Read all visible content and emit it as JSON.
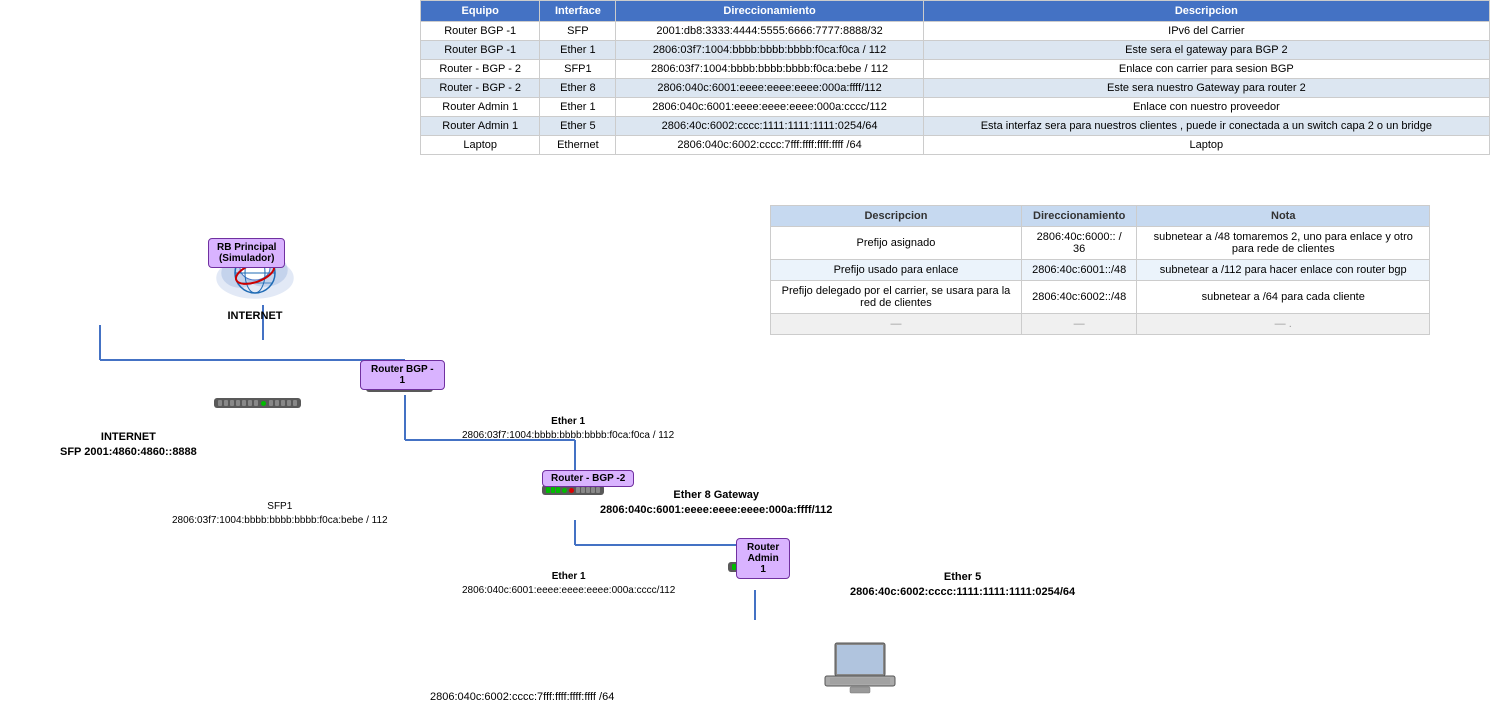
{
  "colors": {
    "header_bg": "#4472c4",
    "header_text": "#ffffff",
    "row_odd": "#ffffff",
    "row_even": "#dce6f1",
    "bottom_header": "#c6d9f0",
    "bottom_even": "#ebf3fb",
    "box_bg": "#d9b3ff",
    "box_border": "#7030a0"
  },
  "top_table": {
    "headers": [
      "Equipo",
      "Interface",
      "Direccionamiento",
      "Descripcion"
    ],
    "rows": [
      {
        "equipo": "Router BGP -1",
        "interface": "SFP",
        "direccionamiento": "2001:db8:3333:4444:5555:6666:7777:8888/32",
        "descripcion": "IPv6 del Carrier"
      },
      {
        "equipo": "Router BGP -1",
        "interface": "Ether 1",
        "direccionamiento": "2806:03f7:1004:bbbb:bbbb:bbbb:f0ca:f0ca / 112",
        "descripcion": "Este sera el gateway para BGP 2"
      },
      {
        "equipo": "Router - BGP - 2",
        "interface": "SFP1",
        "direccionamiento": "2806:03f7:1004:bbbb:bbbb:bbbb:f0ca:bebe / 112",
        "descripcion": "Enlace con carrier para sesion BGP"
      },
      {
        "equipo": "Router - BGP - 2",
        "interface": "Ether 8",
        "direccionamiento": "2806:040c:6001:eeee:eeee:eeee:000a:ffff/112",
        "descripcion": "Este sera nuestro Gateway para router 2"
      },
      {
        "equipo": "Router Admin 1",
        "interface": "Ether 1",
        "direccionamiento": "2806:040c:6001:eeee:eeee:eeee:000a:cccc/112",
        "descripcion": "Enlace con nuestro proveedor"
      },
      {
        "equipo": "Router Admin 1",
        "interface": "Ether 5",
        "direccionamiento": "2806:40c:6002:cccc:1111:1111:1111:0254/64",
        "descripcion": "Esta interfaz sera para nuestros clientes , puede ir conectada a un switch capa 2 o un bridge"
      },
      {
        "equipo": "Laptop",
        "interface": "Ethernet",
        "direccionamiento": "2806:040c:6002:cccc:7fff:ffff:ffff:ffff /64",
        "descripcion": "Laptop"
      }
    ]
  },
  "bottom_table": {
    "headers": [
      "Descripcion",
      "Direccionamiento",
      "Nota"
    ],
    "rows": [
      {
        "descripcion": "Prefijo asignado",
        "direccionamiento": "2806:40c:6000:: / 36",
        "nota": "subnetear a /48  tomaremos 2, uno para enlace y otro para rede de clientes"
      },
      {
        "descripcion": "Prefijo usado para enlace",
        "direccionamiento": "2806:40c:6001::/48",
        "nota": "subnetear a /112 para hacer enlace con router bgp"
      },
      {
        "descripcion": "Prefijo delegado por el carrier, se usara para la red de clientes",
        "direccionamiento": "2806:40c:6002::/48",
        "nota": "subnetear a /64 para cada cliente"
      },
      {
        "descripcion": "—",
        "direccionamiento": "—",
        "nota": "— ."
      }
    ]
  },
  "diagram": {
    "internet_label": "INTERNET",
    "rb_principal_label": "RB Principal\n(Simulador)",
    "router_bgp1_label": "Router BGP -\n1",
    "router_bgp2_label": "Router - BGP -2",
    "router_admin_label": "Router Admin 1",
    "internet_sfp_label": "INTERNET\nSFP 2001:4860:4860::8888",
    "ether1_rb_label": "Ether 1\n2806:03f7:1004:bbbb:bbbb:bbbb:f0ca:f0ca / 112",
    "sfp1_label": "SFP1\n2806:03f7:1004:bbbb:bbbb:bbbb:f0ca:bebe / 112",
    "ether8_label": "Ether 8 Gateway\n2806:040c:6001:eeee:eeee:eeee:000a:ffff/112",
    "ether1_admin_label": "Ether 1\n2806:040c:6001:eeee:eeee:eeee:000a:cccc/112",
    "ether5_label": "Ether 5\n2806:40c:6002:cccc:1111:1111:1111:0254/64",
    "laptop_label": "2806:040c:6002:cccc:7fff:ffff:ffff:ffff /64"
  }
}
